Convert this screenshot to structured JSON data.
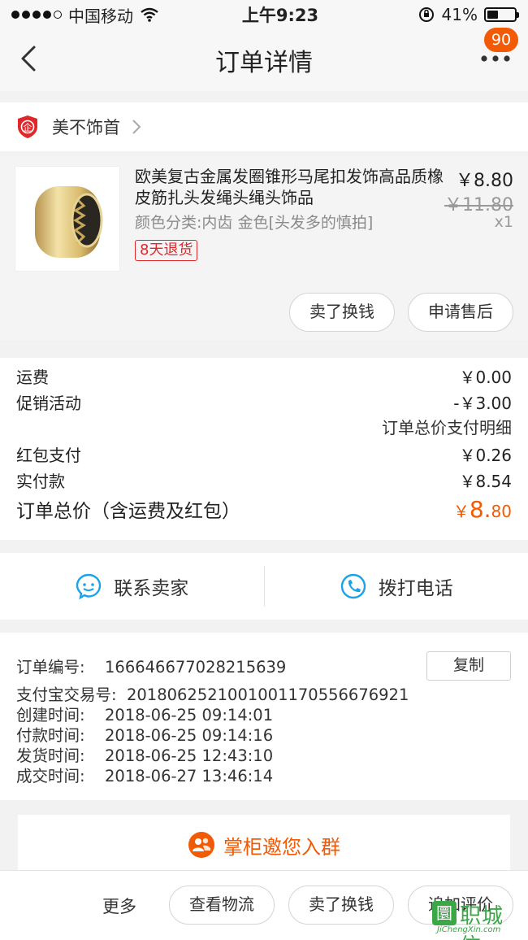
{
  "status_bar": {
    "carrier": "中国移动",
    "time": "上午9:23",
    "battery": "41%",
    "battery_level": 0.41
  },
  "nav": {
    "title": "订单详情",
    "badge": "90"
  },
  "shop": {
    "name": "美不饰首",
    "logo_char": "企"
  },
  "product": {
    "title": "欧美复古金属发圈锥形马尾扣发饰高品质橡皮筋扎头发绳头绳头饰品",
    "sku": "颜色分类:内齿  金色[头发多的慎拍]",
    "return_tag": "8天退货",
    "price": "￥8.80",
    "original_price": "￥11.80",
    "quantity": "x1",
    "actions": [
      "卖了换钱",
      "申请售后"
    ]
  },
  "fees": {
    "shipping_label": "运费",
    "shipping_value": "￥0.00",
    "promo_label": "促销活动",
    "promo_value": "-￥3.00",
    "detail_link": "订单总价支付明细",
    "redpacket_label": "红包支付",
    "redpacket_value": "￥0.26",
    "paid_label": "实付款",
    "paid_value": "￥8.54",
    "total_label": "订单总价（含运费及红包）",
    "total_currency": "￥",
    "total_int": "8.",
    "total_dec": "80"
  },
  "contact": {
    "seller": "联系卖家",
    "call": "拨打电话"
  },
  "order_info": {
    "order_no_label": "订单编号:",
    "order_no": "1666466770282156​39",
    "copy_label": "复制",
    "alipay_label": "支付宝交易号:",
    "alipay_no": "2018062521001001170556676921",
    "created_label": "创建时间:",
    "created": "2018-06-25 09:14:01",
    "paid_label": "付款时间:",
    "paid": "2018-06-25 09:14:16",
    "shipped_label": "发货时间:",
    "shipped": "2018-06-25 12:43:10",
    "completed_label": "成交时间:",
    "completed": "2018-06-27 13:46:14"
  },
  "group_card": {
    "text": "掌柜邀您入群"
  },
  "bottom_bar": {
    "more": "更多",
    "buttons": [
      "查看物流",
      "卖了换钱",
      "追加评价"
    ]
  },
  "watermark": {
    "box_char": "圜",
    "text": "职城信",
    "url": "JiChengXin.com"
  },
  "colors": {
    "accent": "#f25a05",
    "tag_red": "#e0282b",
    "icon_blue": "#1aa3e8"
  }
}
